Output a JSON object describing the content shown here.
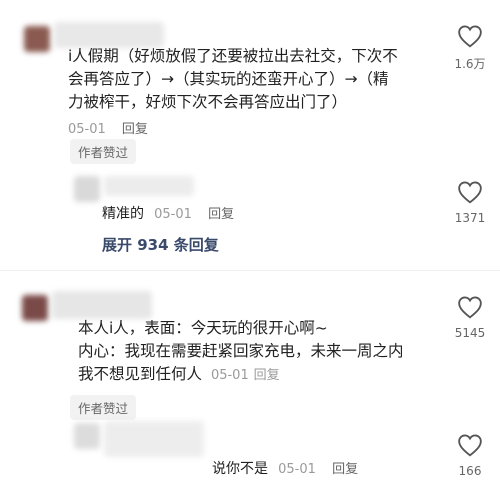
{
  "comments": [
    {
      "text_lines": [
        "i人假期（好烦放假了还要被拉出去社交，下次不",
        "会再答应了）→（其实玩的还蛮开心了）→（精",
        "力被榨干，好烦下次不会再答应出门了）"
      ],
      "date": "05-01",
      "reply_label": "回复",
      "author_liked": "作者赞过",
      "likes": "1.6万",
      "replies": [
        {
          "text": "精准的",
          "date": "05-01",
          "reply_label": "回复",
          "likes": "1371"
        }
      ],
      "expand_label": "展开 934 条回复"
    },
    {
      "text_lines": [
        "本人i人，表面：今天玩的很开心啊~",
        "内心：我现在需要赶紧回家充电，未来一周之内",
        "我不想见到任何人"
      ],
      "date": "05-01",
      "reply_label": "回复",
      "author_liked": "作者赞过",
      "likes": "5145",
      "replies": [
        {
          "text": "说你不是",
          "date": "05-01",
          "reply_label": "回复",
          "likes": "166"
        }
      ]
    }
  ],
  "colors": {
    "avatar1": "#8a5a50",
    "avatar2": "#7a4a48",
    "expand": "#3a4a6b"
  },
  "icons": {
    "like": "heart-outline-icon"
  }
}
